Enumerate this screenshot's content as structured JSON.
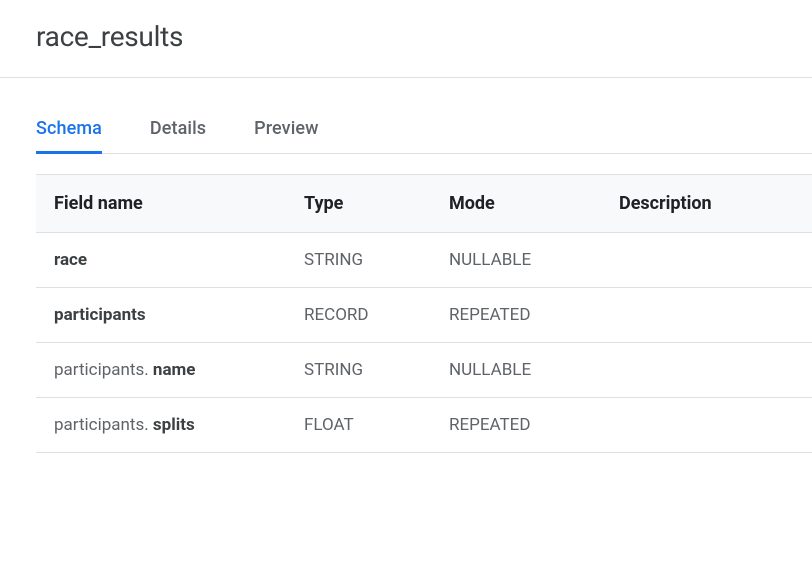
{
  "header": {
    "title": "race_results"
  },
  "tabs": [
    {
      "label": "Schema",
      "active": true
    },
    {
      "label": "Details",
      "active": false
    },
    {
      "label": "Preview",
      "active": false
    }
  ],
  "table": {
    "headers": [
      "Field name",
      "Type",
      "Mode",
      "Description"
    ],
    "rows": [
      {
        "prefix": "",
        "name": "race",
        "type": "STRING",
        "mode": "NULLABLE",
        "description": ""
      },
      {
        "prefix": "",
        "name": "participants",
        "type": "RECORD",
        "mode": "REPEATED",
        "description": ""
      },
      {
        "prefix": "participants. ",
        "name": "name",
        "type": "STRING",
        "mode": "NULLABLE",
        "description": ""
      },
      {
        "prefix": "participants. ",
        "name": "splits",
        "type": "FLOAT",
        "mode": "REPEATED",
        "description": ""
      }
    ]
  }
}
